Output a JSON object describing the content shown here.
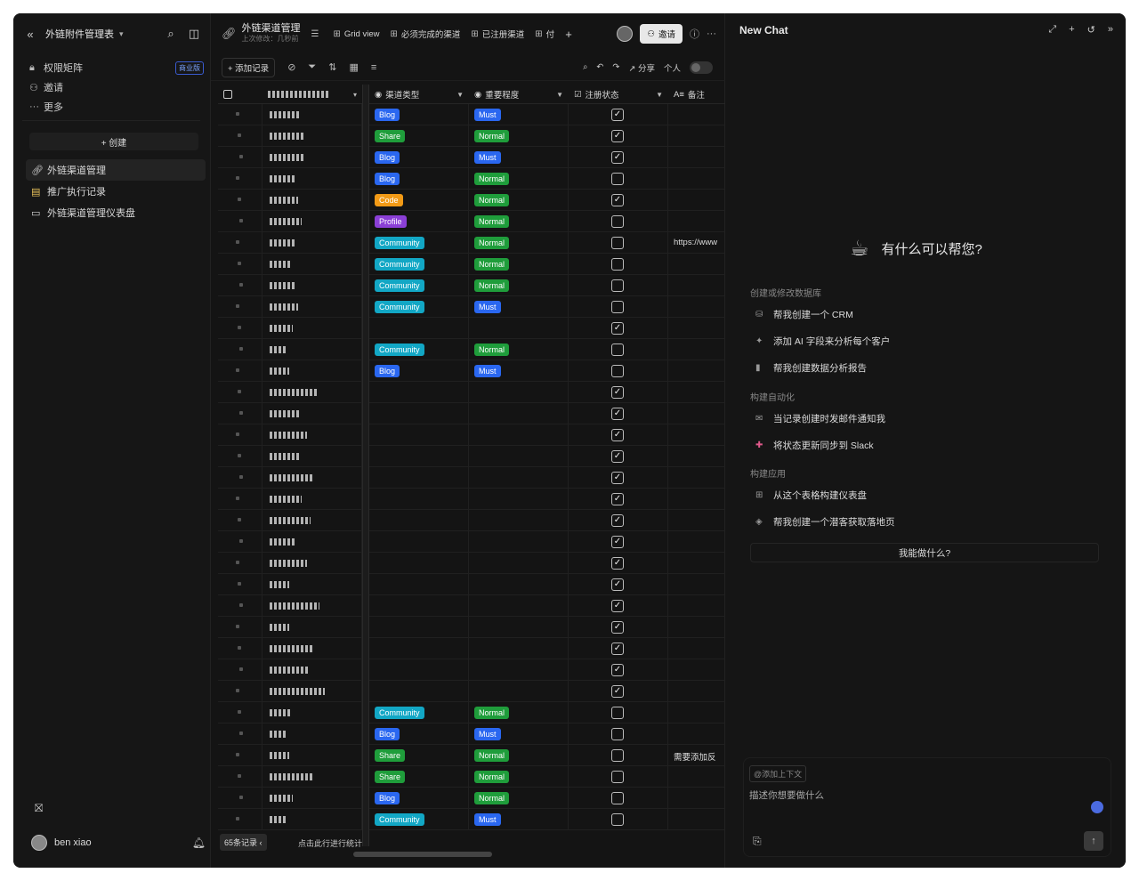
{
  "sidebar": {
    "title": "外链附件管理表",
    "nav": [
      {
        "label": "权限矩阵",
        "icon": "lock-icon",
        "badge": "商业版"
      },
      {
        "label": "邀请",
        "icon": "user-plus-icon"
      },
      {
        "label": "更多",
        "icon": "more-icon"
      }
    ],
    "create_label": "+ 创建",
    "tables": [
      {
        "label": "外链渠道管理",
        "icon": "link-icon",
        "active": true
      },
      {
        "label": "推广执行记录",
        "icon": "note-icon",
        "active": false
      },
      {
        "label": "外链渠道管理仪表盘",
        "icon": "dashboard-icon",
        "active": false
      }
    ],
    "user_name": "ben xiao"
  },
  "header": {
    "title": "外链渠道管理",
    "subtitle": "上次修改：几秒前",
    "tabs": [
      "Grid view",
      "必须完成的渠道",
      "已注册渠道",
      "付"
    ],
    "invite_label": "邀请"
  },
  "toolbar": {
    "add_record": "+ 添加记录",
    "share": "分享",
    "personal": "个人"
  },
  "columns": {
    "type": "渠道类型",
    "level": "重要程度",
    "status": "注册状态",
    "note": "备注"
  },
  "rows": [
    {
      "type": "Blog",
      "level": "Must",
      "done": true,
      "note": ""
    },
    {
      "type": "Share",
      "level": "Normal",
      "done": true,
      "note": ""
    },
    {
      "type": "Blog",
      "level": "Must",
      "done": true,
      "note": ""
    },
    {
      "type": "Blog",
      "level": "Normal",
      "done": false,
      "note": ""
    },
    {
      "type": "Code",
      "level": "Normal",
      "done": true,
      "note": ""
    },
    {
      "type": "Profile",
      "level": "Normal",
      "done": false,
      "note": ""
    },
    {
      "type": "Community",
      "level": "Normal",
      "done": false,
      "note": "https://www"
    },
    {
      "type": "Community",
      "level": "Normal",
      "done": false,
      "note": ""
    },
    {
      "type": "Community",
      "level": "Normal",
      "done": false,
      "note": ""
    },
    {
      "type": "Community",
      "level": "Must",
      "done": false,
      "note": ""
    },
    {
      "type": "",
      "level": "",
      "done": true,
      "note": ""
    },
    {
      "type": "Community",
      "level": "Normal",
      "done": false,
      "note": ""
    },
    {
      "type": "Blog",
      "level": "Must",
      "done": false,
      "note": ""
    },
    {
      "type": "",
      "level": "",
      "done": true,
      "note": ""
    },
    {
      "type": "",
      "level": "",
      "done": true,
      "note": ""
    },
    {
      "type": "",
      "level": "",
      "done": true,
      "note": ""
    },
    {
      "type": "",
      "level": "",
      "done": true,
      "note": ""
    },
    {
      "type": "",
      "level": "",
      "done": true,
      "note": ""
    },
    {
      "type": "",
      "level": "",
      "done": true,
      "note": ""
    },
    {
      "type": "",
      "level": "",
      "done": true,
      "note": ""
    },
    {
      "type": "",
      "level": "",
      "done": true,
      "note": ""
    },
    {
      "type": "",
      "level": "",
      "done": true,
      "note": ""
    },
    {
      "type": "",
      "level": "",
      "done": true,
      "note": ""
    },
    {
      "type": "",
      "level": "",
      "done": true,
      "note": ""
    },
    {
      "type": "",
      "level": "",
      "done": true,
      "note": ""
    },
    {
      "type": "",
      "level": "",
      "done": true,
      "note": ""
    },
    {
      "type": "",
      "level": "",
      "done": true,
      "note": ""
    },
    {
      "type": "",
      "level": "",
      "done": true,
      "note": ""
    },
    {
      "type": "Community",
      "level": "Normal",
      "done": false,
      "note": ""
    },
    {
      "type": "Blog",
      "level": "Must",
      "done": false,
      "note": ""
    },
    {
      "type": "Share",
      "level": "Normal",
      "done": false,
      "note": "需要添加反"
    },
    {
      "type": "Share",
      "level": "Normal",
      "done": false,
      "note": ""
    },
    {
      "type": "Blog",
      "level": "Normal",
      "done": false,
      "note": ""
    },
    {
      "type": "Community",
      "level": "Must",
      "done": false,
      "note": ""
    }
  ],
  "footer": {
    "record_count": "65条记录",
    "stat_hint": "点击此行进行统计"
  },
  "chat": {
    "title": "New Chat",
    "greeting": "有什么可以帮您?",
    "sections": [
      {
        "title": "创建或修改数据库",
        "items": [
          {
            "label": "帮我创建一个 CRM",
            "icon": "database-icon"
          },
          {
            "label": "添加 AI 字段来分析每个客户",
            "icon": "sparkle-icon"
          },
          {
            "label": "帮我创建数据分析报告",
            "icon": "bar-chart-icon"
          }
        ]
      },
      {
        "title": "构建自动化",
        "items": [
          {
            "label": "当记录创建时发邮件通知我",
            "icon": "mail-icon"
          },
          {
            "label": "将状态更新同步到 Slack",
            "icon": "slack-icon"
          }
        ]
      },
      {
        "title": "构建应用",
        "items": [
          {
            "label": "从这个表格构建仪表盘",
            "icon": "grid-icon"
          },
          {
            "label": "帮我创建一个潜客获取落地页",
            "icon": "diamond-icon"
          }
        ]
      }
    ],
    "ask_label": "我能做什么?",
    "context_chip": "@添加上下文",
    "placeholder": "描述你想要做什么"
  }
}
